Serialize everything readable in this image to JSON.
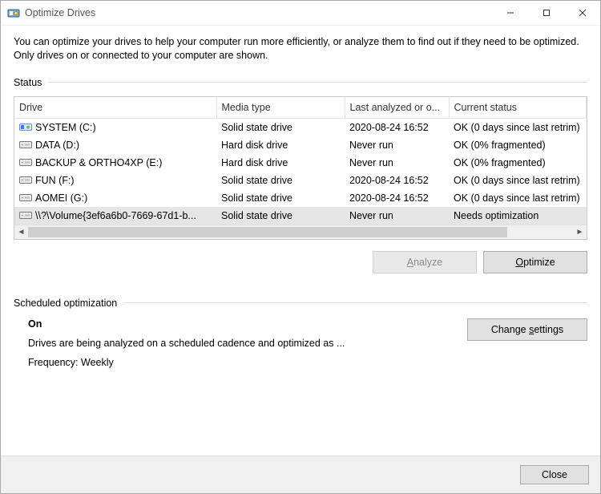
{
  "window": {
    "title": "Optimize Drives"
  },
  "intro": "You can optimize your drives to help your computer run more efficiently, or analyze them to find out if they need to be optimized. Only drives on or connected to your computer are shown.",
  "status_label": "Status",
  "columns": {
    "drive": "Drive",
    "media": "Media type",
    "last": "Last analyzed or o...",
    "status": "Current status"
  },
  "rows": [
    {
      "icon": "system",
      "name": "SYSTEM (C:)",
      "media": "Solid state drive",
      "last": "2020-08-24 16:52",
      "status": "OK (0 days since last retrim)",
      "selected": false
    },
    {
      "icon": "hdd",
      "name": "DATA (D:)",
      "media": "Hard disk drive",
      "last": "Never run",
      "status": "OK (0% fragmented)",
      "selected": false
    },
    {
      "icon": "hdd",
      "name": "BACKUP & ORTHO4XP (E:)",
      "media": "Hard disk drive",
      "last": "Never run",
      "status": "OK (0% fragmented)",
      "selected": false
    },
    {
      "icon": "hdd",
      "name": "FUN (F:)",
      "media": "Solid state drive",
      "last": "2020-08-24 16:52",
      "status": "OK (0 days since last retrim)",
      "selected": false
    },
    {
      "icon": "hdd",
      "name": "AOMEI (G:)",
      "media": "Solid state drive",
      "last": "2020-08-24 16:52",
      "status": "OK (0 days since last retrim)",
      "selected": false
    },
    {
      "icon": "hdd",
      "name": "\\\\?\\Volume{3ef6a6b0-7669-67d1-b...",
      "media": "Solid state drive",
      "last": "Never run",
      "status": "Needs optimization",
      "selected": true
    }
  ],
  "buttons": {
    "analyze_pre": "",
    "analyze_accel": "A",
    "analyze_post": "nalyze",
    "optimize_pre": "",
    "optimize_accel": "O",
    "optimize_post": "ptimize",
    "change_pre": "Change ",
    "change_accel": "s",
    "change_post": "ettings",
    "close": "Close"
  },
  "sched": {
    "label": "Scheduled optimization",
    "on": "On",
    "desc": "Drives are being analyzed on a scheduled cadence and optimized as ...",
    "freq": "Frequency: Weekly"
  }
}
